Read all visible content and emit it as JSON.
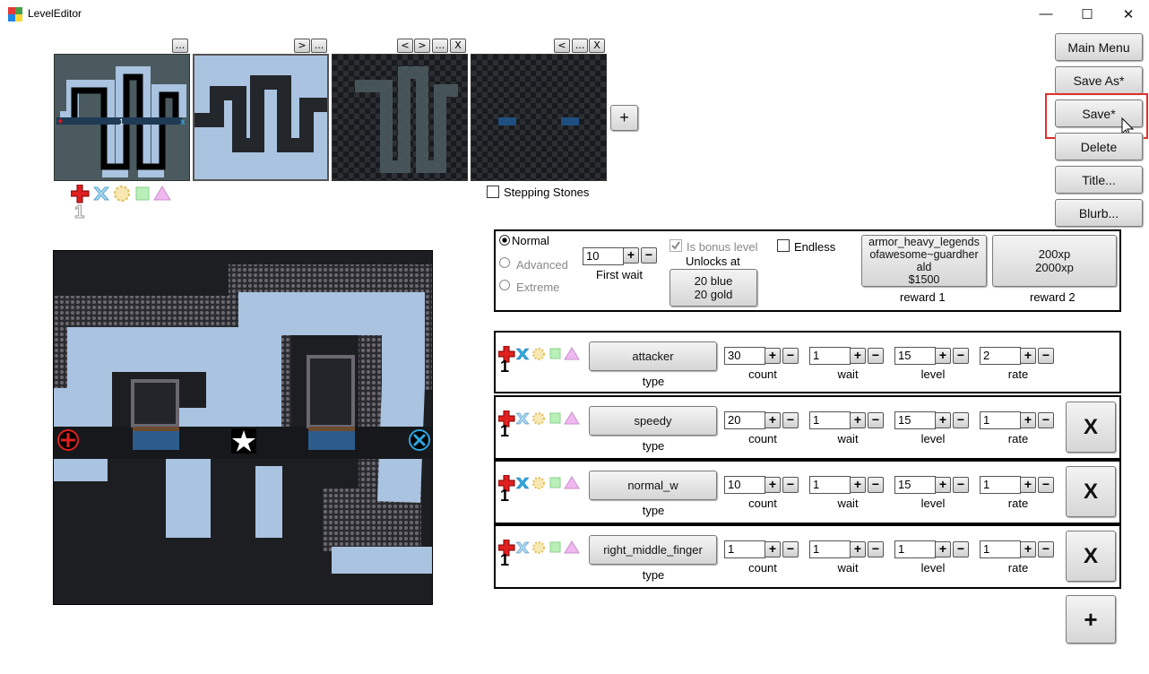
{
  "window": {
    "title": "LevelEditor",
    "minimize": "—",
    "maximize": "☐",
    "close": "✕"
  },
  "sidebar": {
    "main_menu": "Main Menu",
    "save_as": "Save As*",
    "save": "Save*",
    "delete": "Delete",
    "title": "Title...",
    "blurb": "Blurb..."
  },
  "layers": {
    "buttons": [
      [
        "..."
      ],
      [
        ">",
        "..."
      ],
      [
        "<",
        ">",
        "...",
        "X"
      ],
      [
        "<",
        "...",
        "X"
      ]
    ],
    "add": "+",
    "stepping_stones": "Stepping Stones",
    "marker_number": "1"
  },
  "settings": {
    "difficulty": [
      "Normal",
      "Advanced",
      "Extreme"
    ],
    "first_wait_value": "10",
    "first_wait_label": "First wait",
    "bonus_label": "Is bonus level",
    "unlocks_label": "Unlocks at",
    "unlock_value_1": "20 blue",
    "unlock_value_2": "20 gold",
    "endless_label": "Endless",
    "reward1_lines": [
      "armor_heavy_legends",
      "ofawesome~guardher",
      "ald",
      "$1500"
    ],
    "reward1_label": "reward 1",
    "reward2_lines": [
      "200xp",
      "2000xp"
    ],
    "reward2_label": "reward 2"
  },
  "waves": [
    {
      "type": "attacker",
      "count": "30",
      "wait": "1",
      "level": "15",
      "rate": "2"
    },
    {
      "type": "speedy",
      "count": "20",
      "wait": "1",
      "level": "15",
      "rate": "1"
    },
    {
      "type": "normal_w",
      "count": "10",
      "wait": "1",
      "level": "15",
      "rate": "1"
    },
    {
      "type": "right_middle_finger",
      "count": "1",
      "wait": "1",
      "level": "1",
      "rate": "1"
    }
  ],
  "wave_labels": {
    "type": "type",
    "count": "count",
    "wait": "wait",
    "level": "level",
    "rate": "rate",
    "number": "1",
    "plus": "+",
    "minus": "−"
  },
  "wave_delete": "X",
  "wave_add": "+",
  "colors": {
    "red": "#e02020",
    "blue": "#2ea7e0",
    "yellow": "#f2d98a",
    "green": "#a8e6a8",
    "pink": "#e8a8e8",
    "ice": "#a9c3e0",
    "highlight": "#e0302a"
  }
}
